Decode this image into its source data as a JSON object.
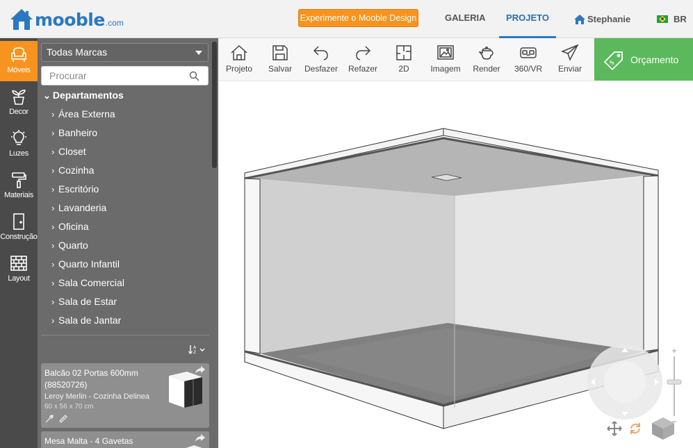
{
  "header": {
    "logo_text": "mooble",
    "logo_suffix": ".com",
    "try_button": "Experimente o Mooble Design",
    "nav": {
      "galeria": "GALERIA",
      "projeto": "PROJETO",
      "user": "Stephanie",
      "lang": "BR"
    }
  },
  "rail": [
    {
      "id": "moveis",
      "label": "Móveis",
      "active": true,
      "icon": "armchair-icon"
    },
    {
      "id": "decor",
      "label": "Decor",
      "icon": "plant-icon"
    },
    {
      "id": "luzes",
      "label": "Luzes",
      "icon": "lightbulb-icon"
    },
    {
      "id": "materiais",
      "label": "Materiais",
      "icon": "paint-roller-icon"
    },
    {
      "id": "construcao",
      "label": "Construção",
      "icon": "door-icon"
    },
    {
      "id": "layout",
      "label": "Layout",
      "icon": "brick-wall-icon"
    }
  ],
  "panel": {
    "brand_select": "Todas Marcas",
    "search_placeholder": "Procurar",
    "tree_head": "Departamentos",
    "categories": [
      "Área Externa",
      "Banheiro",
      "Closet",
      "Cozinha",
      "Escritório",
      "Lavanderia",
      "Oficina",
      "Quarto",
      "Quarto Infantil",
      "Sala Comercial",
      "Sala de Estar",
      "Sala de Jantar"
    ],
    "products": [
      {
        "title": "Balcão 02 Portas 600mm (88520726)",
        "brand": "Leroy Merlin - Cozinha Delinea",
        "dims": "60 x 56 x 70 cm"
      },
      {
        "title": "Mesa Malta - 4 Gavetas"
      }
    ]
  },
  "toolbar": {
    "tools": [
      {
        "id": "projeto",
        "label": "Projeto",
        "icon": "home-icon"
      },
      {
        "id": "salvar",
        "label": "Salvar",
        "icon": "save-icon"
      },
      {
        "id": "desfazer",
        "label": "Desfazer",
        "icon": "undo-icon"
      },
      {
        "id": "refazer",
        "label": "Refazer",
        "icon": "redo-icon"
      },
      {
        "id": "2d",
        "label": "2D",
        "icon": "floorplan-icon"
      },
      {
        "id": "imagem",
        "label": "Imagem",
        "icon": "image-icon"
      },
      {
        "id": "render",
        "label": "Render",
        "icon": "teapot-icon"
      },
      {
        "id": "360vr",
        "label": "360/VR",
        "icon": "vr-headset-icon"
      },
      {
        "id": "enviar",
        "label": "Enviar",
        "icon": "send-icon"
      }
    ],
    "orcamento": "Orçamento"
  },
  "colors": {
    "brand_blue": "#2a78c2",
    "accent_orange": "#f7931e",
    "success_green": "#5cb85c",
    "rail_bg": "#4a4a4a",
    "panel_bg": "#6b6b6b"
  }
}
